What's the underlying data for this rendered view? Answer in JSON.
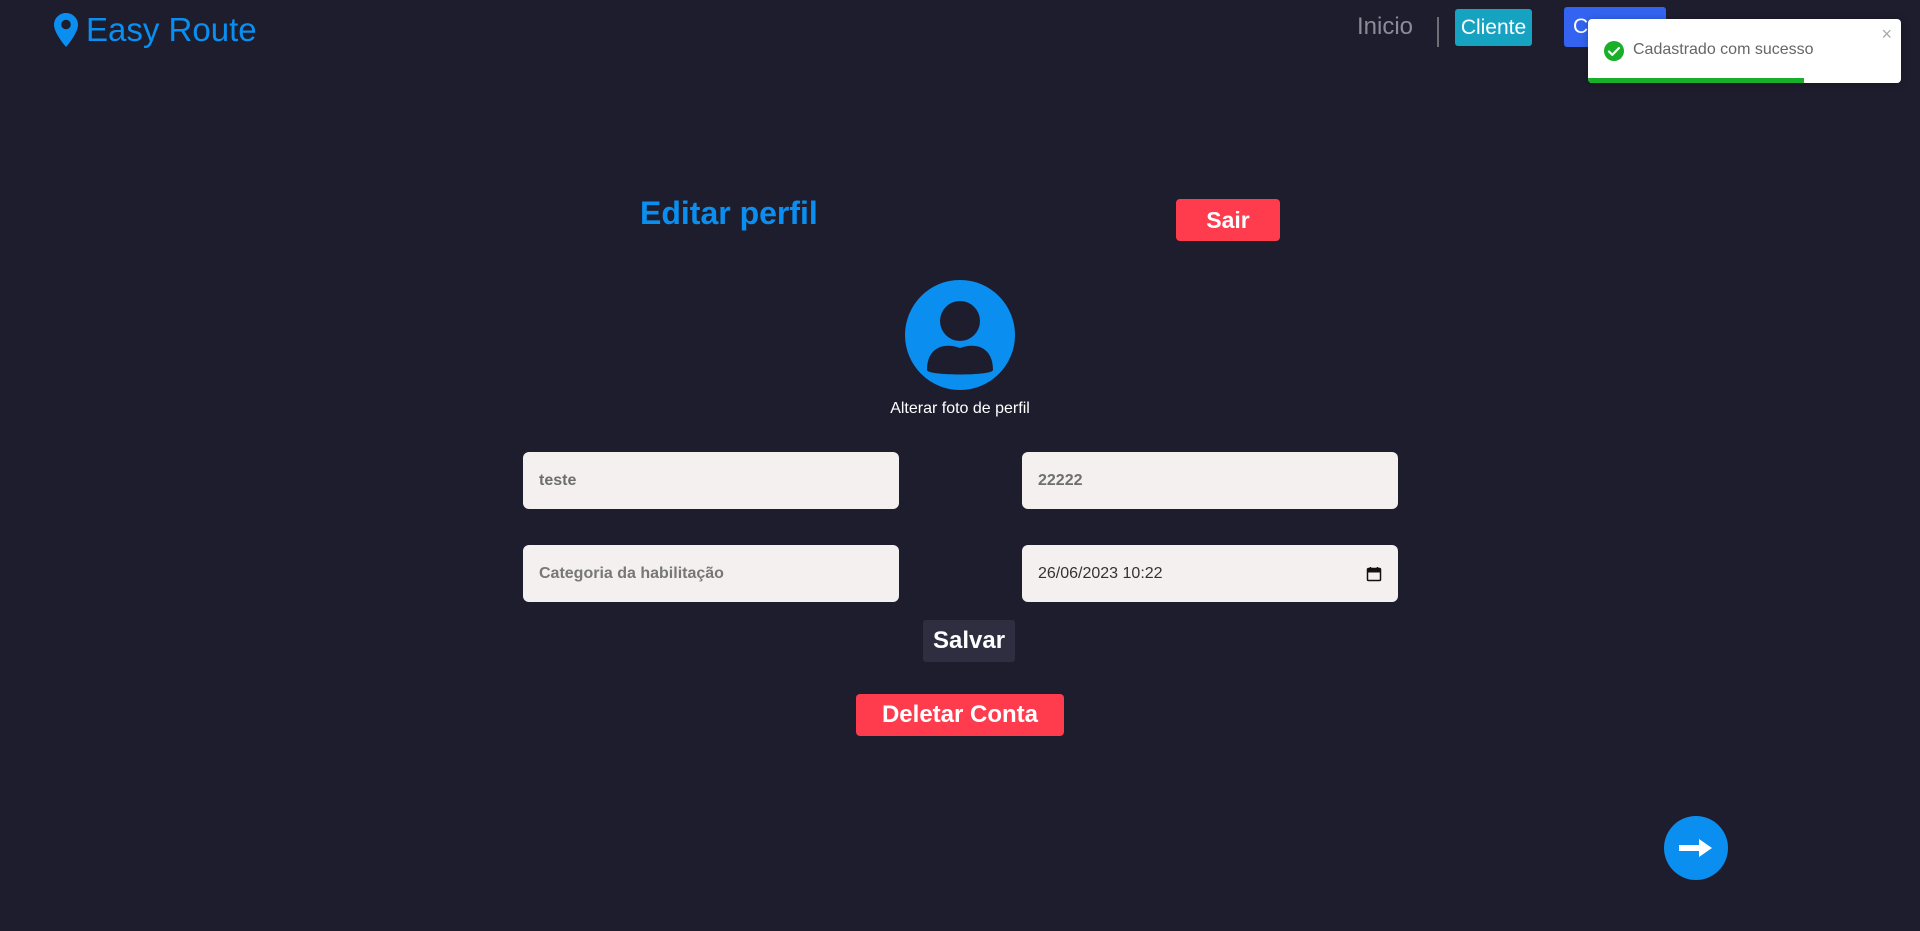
{
  "header": {
    "brand": "Easy Route",
    "nav_inicio": "Inicio",
    "btn_cliente": "Cliente",
    "btn_blue": "Ca"
  },
  "toast": {
    "message": "Cadastrado com sucesso",
    "close": "×",
    "progress": 0.69,
    "color": "#1aaf28"
  },
  "main": {
    "title": "Editar perfil",
    "logout_label": "Sair",
    "avatar_label": "Alterar foto de perfil",
    "fields": {
      "name_value": "teste",
      "number_value": "22222",
      "license_category_placeholder": "Categoria da habilitação",
      "datetime_value": "26/06/2023 10:22"
    },
    "save_label": "Salvar",
    "delete_label": "Deletar Conta"
  },
  "colors": {
    "background": "#1e1d2d",
    "accent": "#0a8ff0",
    "danger": "#ff3b4e",
    "cyan": "#16a3c2",
    "blue": "#3363f0"
  },
  "icons": {
    "brand": "location-pin-icon",
    "avatar": "user-avatar-icon",
    "toast": "check-circle-icon",
    "calendar": "calendar-icon",
    "fab": "arrow-right-icon"
  }
}
